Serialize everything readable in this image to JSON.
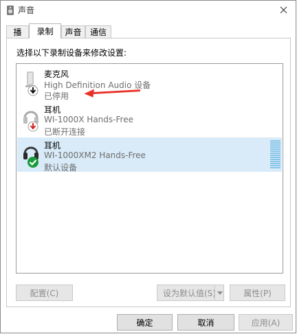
{
  "window": {
    "title": "声音",
    "title_icon": "speaker-icon",
    "close_icon": "close-icon"
  },
  "tabs": [
    {
      "label": "播放"
    },
    {
      "label": "录制",
      "active": true
    },
    {
      "label": "声音"
    },
    {
      "label": "通信"
    }
  ],
  "instruction": "选择以下录制设备来修改设置:",
  "devices": [
    {
      "name": "麦克风",
      "description": "High Definition Audio 设备",
      "status": "已停用",
      "icon": "microphone-icon",
      "badge": "disabled-down-arrow-icon"
    },
    {
      "name": "耳机",
      "description": "WI-1000X Hands-Free",
      "status": "已断开连接",
      "icon": "headset-icon",
      "badge": "disconnected-down-arrow-icon"
    },
    {
      "name": "耳机",
      "description": "WI-1000XM2 Hands-Free",
      "status": "默认设备",
      "icon": "headset-icon",
      "badge": "default-check-icon",
      "selected": true
    }
  ],
  "annotation": {
    "icon": "red-arrow-annotation",
    "color": "#e8312a"
  },
  "buttons": {
    "configure": "配置(C)",
    "set_default": "设为默认值(S)",
    "properties": "属性(P)",
    "ok": "确定",
    "cancel": "取消",
    "apply": "应用(A)"
  },
  "colors": {
    "selection": "#d9ebf8",
    "level": "#86c5e9",
    "check": "#1a9a3a"
  }
}
